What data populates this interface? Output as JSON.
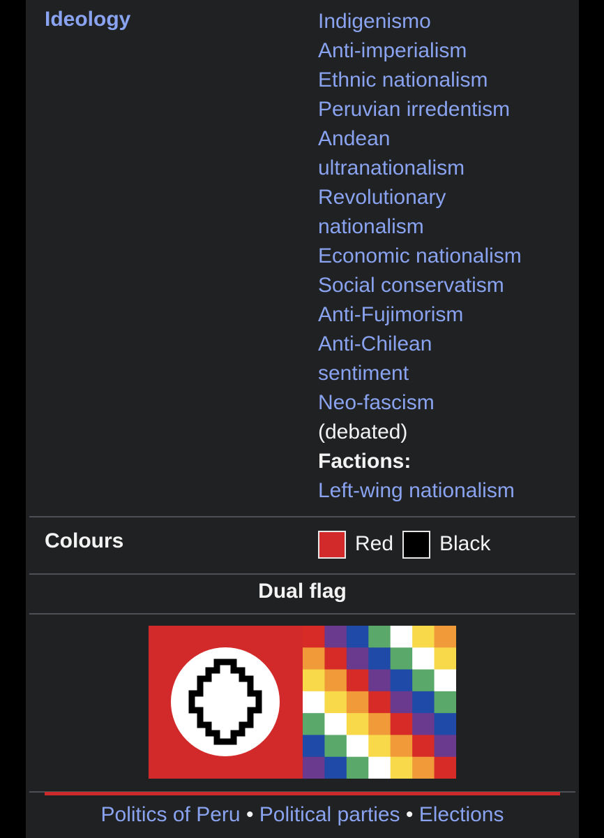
{
  "infobox": {
    "ideology": {
      "label": "Ideology",
      "lines": [
        {
          "text": "Indigenismo",
          "kind": "link"
        },
        {
          "text": "Anti-imperialism",
          "kind": "link"
        },
        {
          "text": "Ethnic nationalism",
          "kind": "link"
        },
        {
          "text": "Peruvian irredentism",
          "kind": "link"
        },
        {
          "text": "Andean",
          "kind": "link"
        },
        {
          "text": "ultranationalism",
          "kind": "link"
        },
        {
          "text": "Revolutionary",
          "kind": "link"
        },
        {
          "text": "nationalism",
          "kind": "link"
        },
        {
          "text": "Economic nationalism",
          "kind": "link"
        },
        {
          "text": "Social conservatism",
          "kind": "link"
        },
        {
          "text": "Anti-Fujimorism",
          "kind": "link"
        },
        {
          "text": "Anti-Chilean",
          "kind": "link"
        },
        {
          "text": "sentiment",
          "kind": "link"
        },
        {
          "text": "Neo-fascism",
          "kind": "link"
        },
        {
          "text": "(debated)",
          "kind": "plain"
        },
        {
          "text": "Factions:",
          "kind": "bold"
        },
        {
          "text": "Left-wing nationalism",
          "kind": "link"
        }
      ]
    },
    "colours": {
      "label": "Colours",
      "items": [
        {
          "name": "Red",
          "hex": "#d22a2a"
        },
        {
          "name": "Black",
          "hex": "#000000"
        }
      ]
    },
    "dual_flag_title": "Dual flag",
    "flag": {
      "red": "#d22a2a",
      "circle": "#ffffff",
      "cross": "#000000",
      "wiphala_colors": [
        "#d62b26",
        "#6a3a8e",
        "#1f4aa8",
        "#5aa86a",
        "#ffffff",
        "#f7d94a",
        "#f09a3a"
      ]
    }
  },
  "footer": {
    "links": [
      "Politics of Peru",
      "Political parties",
      "Elections"
    ],
    "separator": " • "
  }
}
